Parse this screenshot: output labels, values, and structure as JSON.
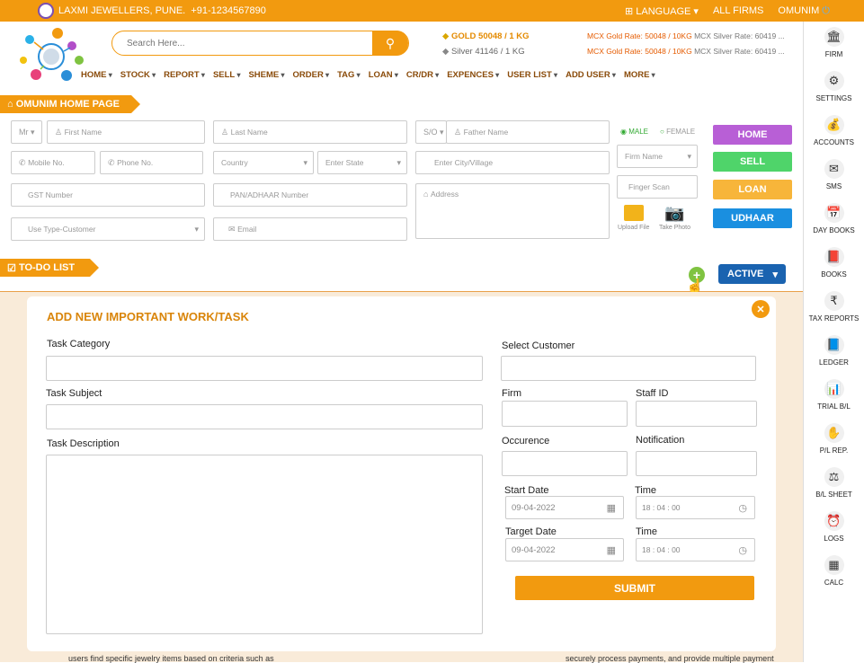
{
  "topbar": {
    "shop": "LAXMI JEWELLERS, PUNE.",
    "phone": "+91-1234567890",
    "language": "LANGUAGE",
    "all_firms": "ALL FIRMS",
    "user": "OMUNIM"
  },
  "search": {
    "placeholder": "Search Here..."
  },
  "rates": {
    "gold": "GOLD 50048 / 1 KG",
    "silver": "Silver 41146 / 1 KG",
    "mcx_gold_1": "MCX Gold Rate: 50048 / 10KG",
    "mcx_silver_1": "MCX Silver Rate: 60419 ...",
    "mcx_gold_2": "MCX Gold Rate: 50048 / 10KG",
    "mcx_silver_2": "MCX Silver Rate: 60419 ..."
  },
  "nav": [
    "HOME",
    "STOCK",
    "REPORT",
    "SELL",
    "SHEME",
    "ORDER",
    "TAG",
    "LOAN",
    "CR/DR",
    "EXPENCES",
    "USER LIST",
    "ADD USER",
    "MORE"
  ],
  "sidebar": [
    "FIRM",
    "SETTINGS",
    "ACCOUNTS",
    "SMS",
    "DAY BOOKS",
    "BOOKS",
    "TAX REPORTS",
    "LEDGER",
    "TRIAL B/L",
    "P/L REP.",
    "B/L SHEET",
    "LOGS",
    "CALC"
  ],
  "home_section": {
    "title": "OMUNIM HOME PAGE"
  },
  "form": {
    "title_select": "Mr",
    "first_name": "First Name",
    "last_name": "Last Name",
    "relation_select": "S/O",
    "father_name": "Father Name",
    "gender_male": "MALE",
    "gender_female": "FEMALE",
    "mobile": "Mobile No.",
    "phone": "Phone No.",
    "country": "Country",
    "state": "Enter State",
    "city": "Enter City/Village",
    "firm_name": "Firm Name",
    "gst": "GST Number",
    "pan": "PAN/ADHAAR Number",
    "address": "Address",
    "finger_scan": "Finger Scan",
    "use_type": "Use Type-Customer",
    "email": "Email",
    "upload_file": "Upload File",
    "take_photo": "Take Photo"
  },
  "side_buttons": {
    "home": "HOME",
    "sell": "SELL",
    "loan": "LOAN",
    "udhaar": "UDHAAR"
  },
  "todo": {
    "title": "TO-DO LIST",
    "active": "ACTIVE"
  },
  "modal": {
    "title": "ADD NEW IMPORTANT WORK/TASK",
    "task_category": "Task Category",
    "task_subject": "Task Subject",
    "task_description": "Task Description",
    "select_customer": "Select Customer",
    "firm": "Firm",
    "staff_id": "Staff ID",
    "occurence": "Occurence",
    "notification": "Notification",
    "start_date_label": "Start Date",
    "start_date": "09-04-2022",
    "time_label_1": "Time",
    "time_1": "18 : 04 : 00",
    "target_date_label": "Target Date",
    "target_date": "09-04-2022",
    "time_label_2": "Time",
    "time_2": "18 : 04 : 00",
    "submit": "SUBMIT"
  },
  "bottom": {
    "left_text": "users find specific jewelry items based on criteria such as",
    "right_text": "securely process payments, and provide multiple payment"
  },
  "colors": {
    "accent": "#f29a0f",
    "home_btn": "#b85fd6",
    "sell_btn": "#4fd46a",
    "loan_btn": "#f7b53a",
    "udhaar_btn": "#1a8fe0",
    "active_btn": "#1a63b0"
  }
}
